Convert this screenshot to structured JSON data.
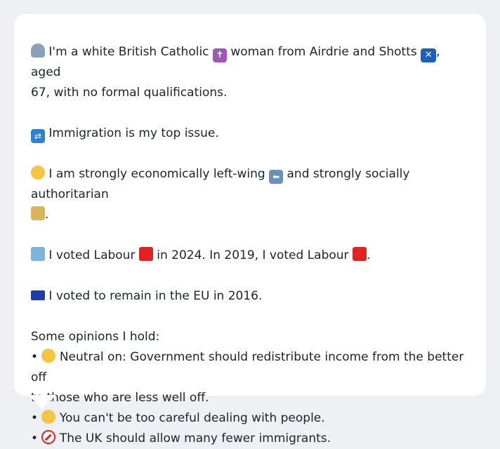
{
  "profile": {
    "identity_line1": "I'm a white British Catholic",
    "identity_line1b": "woman from Airdrie and Shotts",
    "identity_line1c": ", aged",
    "identity_line2": "67, with no formal qualifications.",
    "top_issue": "Immigration is my top issue.",
    "ideology_a": "I am strongly economically left-wing",
    "ideology_b": "and strongly socially authoritarian",
    "ideology_end": ".",
    "vote_a": "I voted Labour",
    "vote_b": "in 2024. In 2019, I voted Labour",
    "vote_end": ".",
    "eu_vote": "I voted to remain in the EU in 2016.",
    "opinions_header": "Some opinions I hold:",
    "opinions": [
      {
        "bullet": "•",
        "text_line1": "Neutral on: Government should redistribute income from the better off",
        "text_line2": "to those who are less well off."
      },
      {
        "bullet": "•",
        "text_line1": "You can't be too careful dealing with people."
      },
      {
        "bullet": "•",
        "text_line1": "The UK should allow many fewer immigrants."
      }
    ]
  },
  "icons": {
    "person": "bust-in-silhouette-icon",
    "cross": "latin-cross-icon",
    "scotland": "scotland-flag-icon",
    "passport": "passport-control-icon",
    "thinking": "thinking-face-icon",
    "left_arrow": "left-arrow-icon",
    "lock": "locked-icon",
    "ballot": "ballot-box-icon",
    "labour": "red-square-icon",
    "eu": "eu-flag-icon",
    "neutral": "neutral-face-icon",
    "raised_eyebrow": "raised-eyebrow-face-icon",
    "no_entry": "prohibited-icon"
  },
  "colors": {
    "background": "#eef0f3",
    "card": "#ffffff",
    "text": "#1f2328",
    "labour_red": "#e02424",
    "eu_blue": "#1d3fa5"
  }
}
